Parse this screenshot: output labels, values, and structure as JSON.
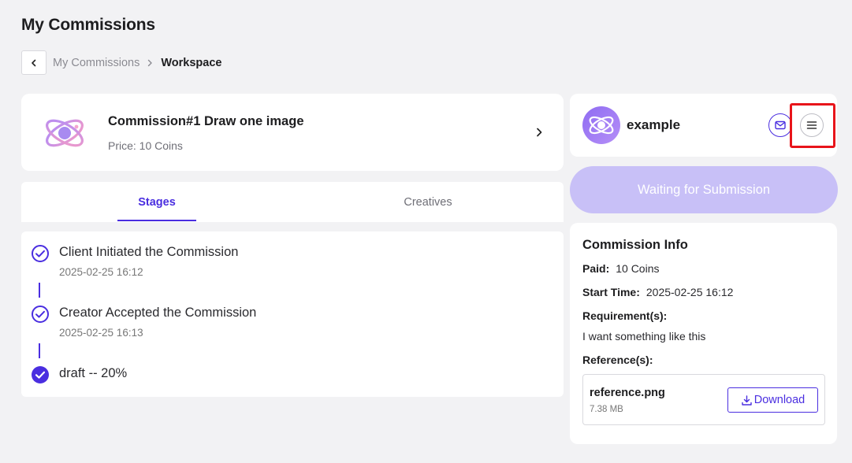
{
  "page": {
    "title": "My Commissions"
  },
  "breadcrumb": {
    "parent": "My Commissions",
    "current": "Workspace"
  },
  "commission": {
    "title": "Commission#1 Draw one image",
    "price": "Price: 10 Coins"
  },
  "tabs": [
    {
      "label": "Stages",
      "active": true
    },
    {
      "label": "Creatives",
      "active": false
    }
  ],
  "stages": [
    {
      "title": "Client Initiated the Commission",
      "time": "2025-02-25 16:12",
      "state": "done"
    },
    {
      "title": "Creator Accepted the Commission",
      "time": "2025-02-25 16:13",
      "state": "done"
    },
    {
      "title": "draft -- 20%",
      "time": "",
      "state": "current"
    }
  ],
  "creator": {
    "name": "example"
  },
  "status_button": {
    "label": "Waiting for Submission"
  },
  "info": {
    "title": "Commission Info",
    "paid_label": "Paid:",
    "paid_value": "10 Coins",
    "start_label": "Start Time:",
    "start_value": "2025-02-25 16:12",
    "requirements_label": "Requirement(s):",
    "requirements_value": "I want something like this",
    "references_label": "Reference(s):",
    "reference": {
      "name": "reference.png",
      "size": "7.38 MB",
      "download_label": "Download"
    }
  },
  "icons": {
    "back": "chevron-left-icon",
    "breadcrumb_separator": "chevron-right-icon",
    "commission_open": "chevron-right-icon",
    "logo": "atom-logo-icon",
    "mail": "mail-icon",
    "menu": "menu-icon",
    "stage_done": "check-circle-outline-icon",
    "stage_current": "check-circle-filled-icon",
    "download": "download-icon"
  },
  "colors": {
    "accent": "#4a2ee0",
    "status_button_bg": "#c8c0f7",
    "highlight": "#e8141a",
    "background": "#f2f2f4"
  }
}
